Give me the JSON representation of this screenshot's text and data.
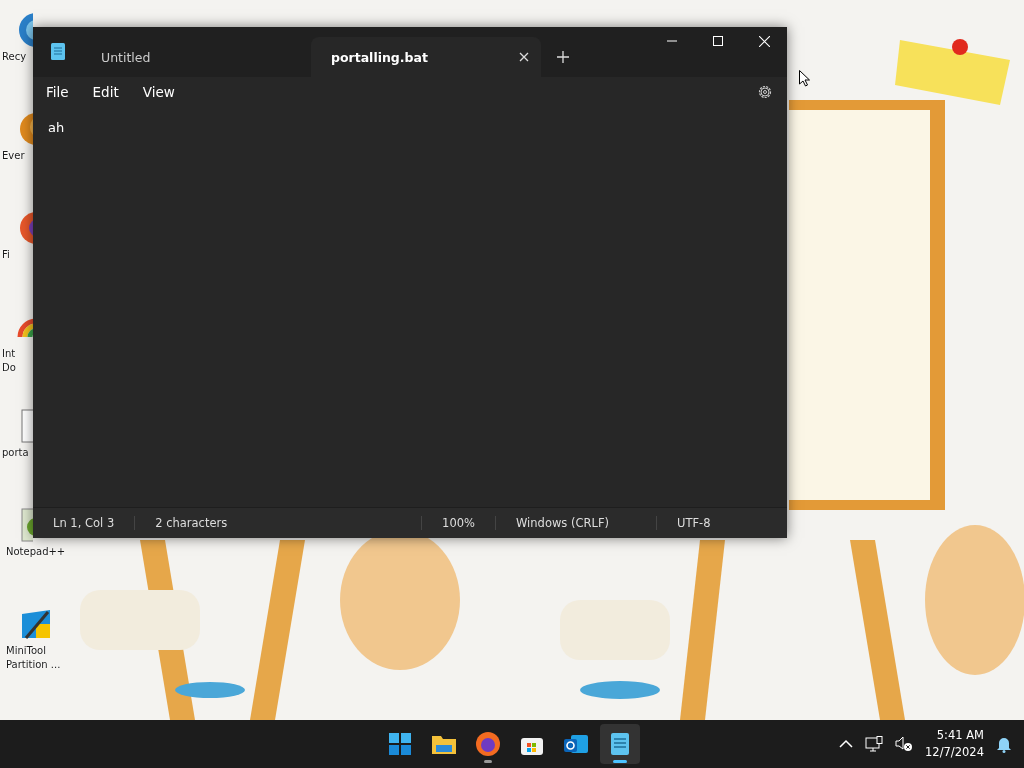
{
  "desktop_icons": [
    {
      "lines": [
        "Recy"
      ]
    },
    {
      "lines": [
        "Ever"
      ]
    },
    {
      "lines": [
        "Fi"
      ]
    },
    {
      "lines": [
        "Int",
        "Do"
      ]
    },
    {
      "lines": [
        "porta"
      ]
    },
    {
      "lines": [
        "Notepad++"
      ]
    },
    {
      "lines": [
        "MiniTool",
        "Partition ..."
      ]
    }
  ],
  "window": {
    "tabs": [
      {
        "title": "Untitled",
        "selected": false
      },
      {
        "title": "portalling.bat",
        "selected": true
      }
    ],
    "menu": [
      "File",
      "Edit",
      "View"
    ],
    "content": "ah",
    "status_bar": {
      "position": "Ln 1, Col 3",
      "characters": "2 characters",
      "zoom": "100%",
      "line_endings": "Windows (CRLF)",
      "encoding": "UTF-8"
    }
  },
  "taskbar": {
    "apps": [
      {
        "open": false,
        "selected": false
      },
      {
        "open": false,
        "selected": false
      },
      {
        "open": true,
        "selected": false
      },
      {
        "open": false,
        "selected": false
      },
      {
        "open": false,
        "selected": false
      },
      {
        "open": true,
        "selected": true
      }
    ],
    "time": "5:41 AM",
    "date": "12/7/2024"
  }
}
